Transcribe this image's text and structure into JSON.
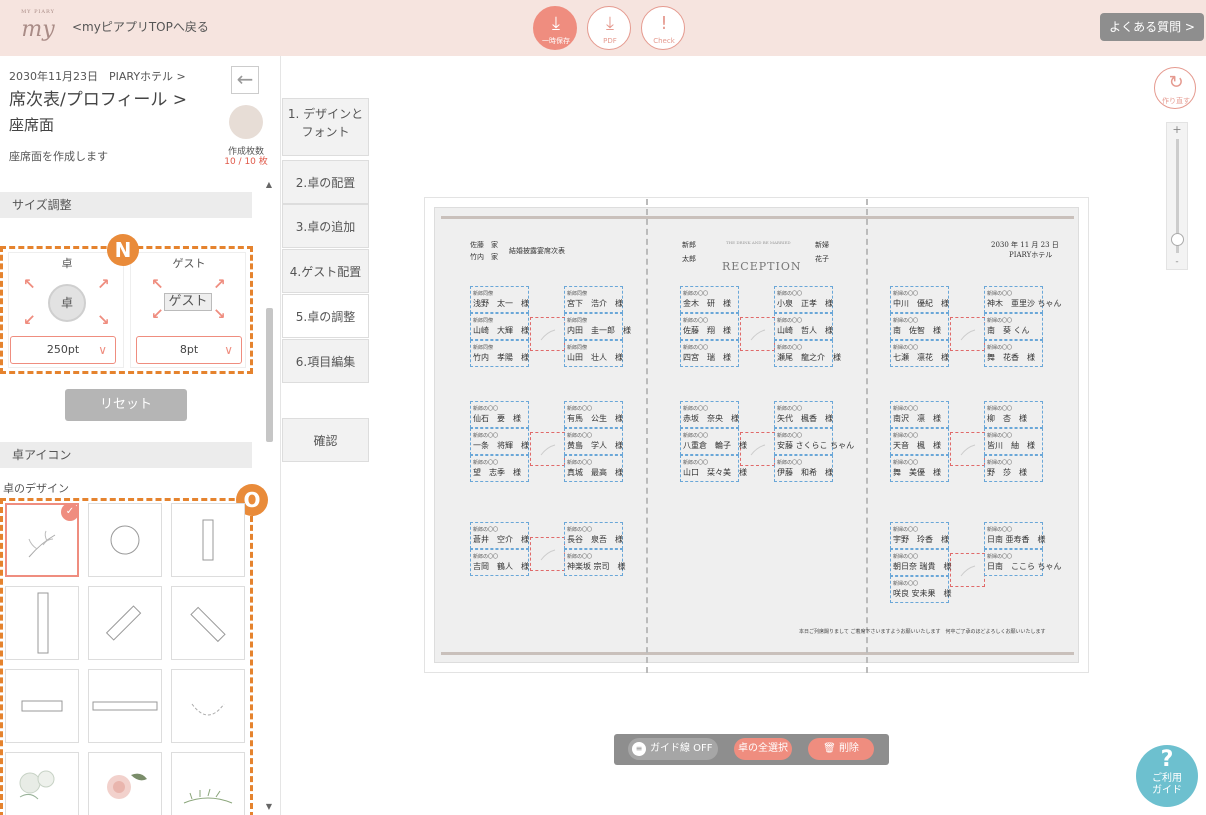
{
  "header": {
    "back_link": "<myピアプリTOPへ戻る",
    "logo_text": "my",
    "logo_sub": "MY PIARY",
    "buttons": [
      {
        "icon": "save-icon",
        "label": "一時保存"
      },
      {
        "icon": "pdf-download-icon",
        "label": "PDF"
      },
      {
        "icon": "check-icon",
        "label": "Check"
      }
    ],
    "faq": "よくある質問 >"
  },
  "sidebar": {
    "breadcrumb": "2030年11月23日　PIARYホテル >",
    "section_title": "席次表/プロフィール >",
    "subtitle": "座席面",
    "description": "座席面を作成します",
    "count_label": "作成枚数",
    "count_value": "10 / 10 枚",
    "size_panel": {
      "heading": "サイズ調整",
      "table_label": "卓",
      "table_icon_text": "卓",
      "table_value": "250pt",
      "guest_label": "ゲスト",
      "guest_icon_text": "ゲスト",
      "guest_value": "8pt",
      "reset": "リセット",
      "badge": "N"
    },
    "icon_panel": {
      "heading": "卓アイコン",
      "design_label": "卓のデザイン",
      "badge": "O",
      "tiles": [
        "leaf",
        "circle",
        "vertical-rect",
        "tall-rect",
        "diagonal-rect-right",
        "diagonal-rect-left",
        "horizontal-rect",
        "wide-rect",
        "wreath",
        "white-flowers",
        "pink-rose",
        "green-sprig"
      ]
    }
  },
  "steps": [
    {
      "num": "1.",
      "label": "デザインと\nフォント"
    },
    {
      "label": "2.卓の配置"
    },
    {
      "label": "3.卓の追加"
    },
    {
      "label": "4.ゲスト配置"
    },
    {
      "label": "5.卓の調整"
    },
    {
      "label": "6.項目編集"
    }
  ],
  "confirm": "確認",
  "canvas": {
    "left_family": [
      "佐藤　家",
      "竹内　家"
    ],
    "left_title": "結婚披露宴席次表",
    "groom_label": "新郎",
    "groom_name": "太郎",
    "bride_label": "新婦",
    "bride_name": "花子",
    "reception_sub": "THE DRINK AND BE MARRIED",
    "reception_title": "RECEPTION",
    "date": "2030 年 11 月 23 日",
    "venue": "PIARYホテル",
    "footnote": "本日ご列席賜りまして ご着席下さいますようお願いいたします　何卒ご了承のほどよろしくお願いいたします",
    "guests": [
      {
        "r": "新郎同僚",
        "n": "浅野　太一　様"
      },
      {
        "r": "新郎同僚",
        "n": "宮下　浩介　様"
      },
      {
        "r": "新郎同僚",
        "n": "山崎　大輝　様"
      },
      {
        "r": "新郎同僚",
        "n": "内田　圭一郎　様"
      },
      {
        "r": "新郎同僚",
        "n": "竹内　孝陽　様"
      },
      {
        "r": "新郎同僚",
        "n": "山田　壮人　様"
      },
      {
        "r": "新郎の〇〇",
        "n": "金木　研　様"
      },
      {
        "r": "新郎の〇〇",
        "n": "小泉　正孝　様"
      },
      {
        "r": "新郎の〇〇",
        "n": "佐藤　翔　様"
      },
      {
        "r": "新郎の〇〇",
        "n": "山崎　哲人　様"
      },
      {
        "r": "新郎の〇〇",
        "n": "四宮　瑞　様"
      },
      {
        "r": "新郎の〇〇",
        "n": "瀬尾　龍之介　様"
      },
      {
        "r": "新婦の〇〇",
        "n": "中川　優紀　様"
      },
      {
        "r": "新婦の〇〇",
        "n": "神木　亜里沙 ちゃん"
      },
      {
        "r": "新婦の〇〇",
        "n": "南　佐智　様"
      },
      {
        "r": "新婦の〇〇",
        "n": "南　葵 くん"
      },
      {
        "r": "新婦の〇〇",
        "n": "七瀬　凛花　様"
      },
      {
        "r": "新婦の〇〇",
        "n": "舞　花香　様"
      },
      {
        "r": "新郎の〇〇",
        "n": "仙石　要　様"
      },
      {
        "r": "新郎の〇〇",
        "n": "有馬　公生　様"
      },
      {
        "r": "新郎の〇〇",
        "n": "一条　将輝　様"
      },
      {
        "r": "新郎の〇〇",
        "n": "黄島　学人　様"
      },
      {
        "r": "新郎の〇〇",
        "n": "望　志季　様"
      },
      {
        "r": "新郎の〇〇",
        "n": "真城　最高　様"
      },
      {
        "r": "新郎の〇〇",
        "n": "赤坂　奈央　様"
      },
      {
        "r": "新郎の〇〇",
        "n": "矢代　楓香　様"
      },
      {
        "r": "新郎の〇〇",
        "n": "八重倉　輪子　様"
      },
      {
        "r": "新郎の〇〇",
        "n": "安藤 さくらこ ちゃん"
      },
      {
        "r": "新郎の〇〇",
        "n": "山口　栞々美　様"
      },
      {
        "r": "新郎の〇〇",
        "n": "伊藤　和希　様"
      },
      {
        "r": "新婦の〇〇",
        "n": "南沢　凛　様"
      },
      {
        "r": "新婦の〇〇",
        "n": "柳　杏　様"
      },
      {
        "r": "新婦の〇〇",
        "n": "天音　楓　様"
      },
      {
        "r": "新婦の〇〇",
        "n": "皆川　紬　様"
      },
      {
        "r": "新婦の〇〇",
        "n": "舞　美優　様"
      },
      {
        "r": "新婦の〇〇",
        "n": "野　莎　様"
      },
      {
        "r": "新郎の〇〇",
        "n": "蒼井　空介　様"
      },
      {
        "r": "新郎の〇〇",
        "n": "長谷　泉吾　様"
      },
      {
        "r": "新郎の〇〇",
        "n": "吉岡　鶴人　様"
      },
      {
        "r": "新郎の〇〇",
        "n": "神楽坂 宗司　様"
      },
      {
        "r": "新婦の〇〇",
        "n": "宇野　玲香　様"
      },
      {
        "r": "新婦の〇〇",
        "n": "日南 亜寿香　様"
      },
      {
        "r": "新婦の〇〇",
        "n": "朝日奈 瑞貴　様"
      },
      {
        "r": "新婦の〇〇",
        "n": "日南　ここら ちゃん"
      },
      {
        "r": "新婦の〇〇",
        "n": "咲良 安未果　様"
      }
    ]
  },
  "tools": {
    "redo": "作り直す",
    "zoom_plus": "+",
    "zoom_minus": "-",
    "zoom_level": 0.1
  },
  "bottom_bar": {
    "guide": "ガイド線 OFF",
    "select_all": "卓の全選択",
    "delete": "削除"
  },
  "help": {
    "q": "?",
    "label": "ご利用\nガイド"
  },
  "colors": {
    "accent": "#ef8d7f",
    "badge": "#e98b3a",
    "topbar": "#f6e4df"
  }
}
